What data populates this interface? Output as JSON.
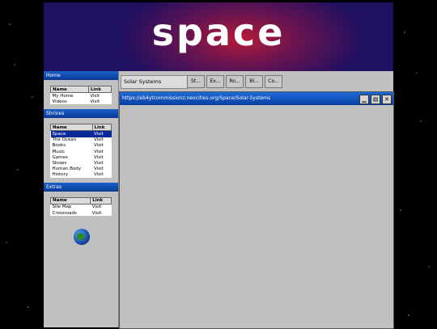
{
  "banner": {
    "title": "space"
  },
  "sidebar": {
    "sections": [
      {
        "title": "Home",
        "headers": [
          "Name",
          "Link"
        ],
        "rows": [
          {
            "name": "My Home",
            "link": "Visit"
          },
          {
            "name": "Videos",
            "link": "Visit"
          }
        ]
      },
      {
        "title": "Shrines",
        "headers": [
          "Name",
          "Link"
        ],
        "rows": [
          {
            "name": "Space",
            "link": "Visit"
          },
          {
            "name": "The Ocean",
            "link": "Visit"
          },
          {
            "name": "Books",
            "link": "Visit"
          },
          {
            "name": "Music",
            "link": "Visit"
          },
          {
            "name": "Games",
            "link": "Visit"
          },
          {
            "name": "Shows",
            "link": "Visit"
          },
          {
            "name": "Human Body",
            "link": "Visit"
          },
          {
            "name": "History",
            "link": "Visit"
          }
        ]
      },
      {
        "title": "Extras",
        "headers": [
          "Name",
          "Link"
        ],
        "rows": [
          {
            "name": "Site Map",
            "link": "Visit"
          },
          {
            "name": "Crossroads",
            "link": "Visit"
          }
        ]
      }
    ],
    "selected_row": "Space",
    "globe_icon": "globe-icon"
  },
  "tabs": {
    "current": "Solar Systems",
    "items": [
      "St...",
      "Ex...",
      "Ro...",
      "Bl...",
      "Co..."
    ]
  },
  "window": {
    "url": "https://eb4ytcommissionz.neocities.org/Space/Solar-Systems",
    "buttons": [
      "minimize-icon",
      "maximize-icon",
      "close-icon"
    ]
  },
  "colors": {
    "titlebar": "#0a3fa0",
    "selection": "#0a2a9a",
    "background": "#c0c0c0"
  }
}
